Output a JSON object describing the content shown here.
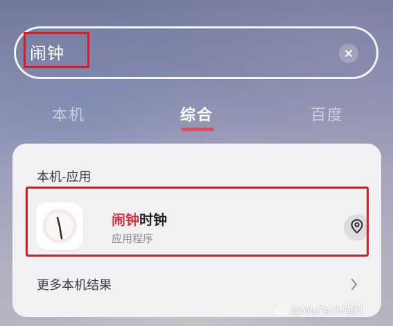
{
  "search": {
    "query": "闹钟",
    "clear_icon": "close-icon"
  },
  "tabs": [
    {
      "label": "本机",
      "active": false
    },
    {
      "label": "综合",
      "active": true
    },
    {
      "label": "百度",
      "active": false
    }
  ],
  "results": {
    "section_title": "本机-应用",
    "app": {
      "name_highlight": "闹钟",
      "name_rest": "时钟",
      "subtitle": "应用程序",
      "icon": "clock-icon",
      "action_icon": "location-pin-icon"
    },
    "more_label": "更多本机结果",
    "more_icon": "chevron-right-icon"
  },
  "watermark": {
    "text": "@MiuTech喵科",
    "icon": "weibo-icon"
  },
  "colors": {
    "accent": "#e24a5e",
    "highlight": "#d8323f",
    "annotation": "#e5161c"
  }
}
